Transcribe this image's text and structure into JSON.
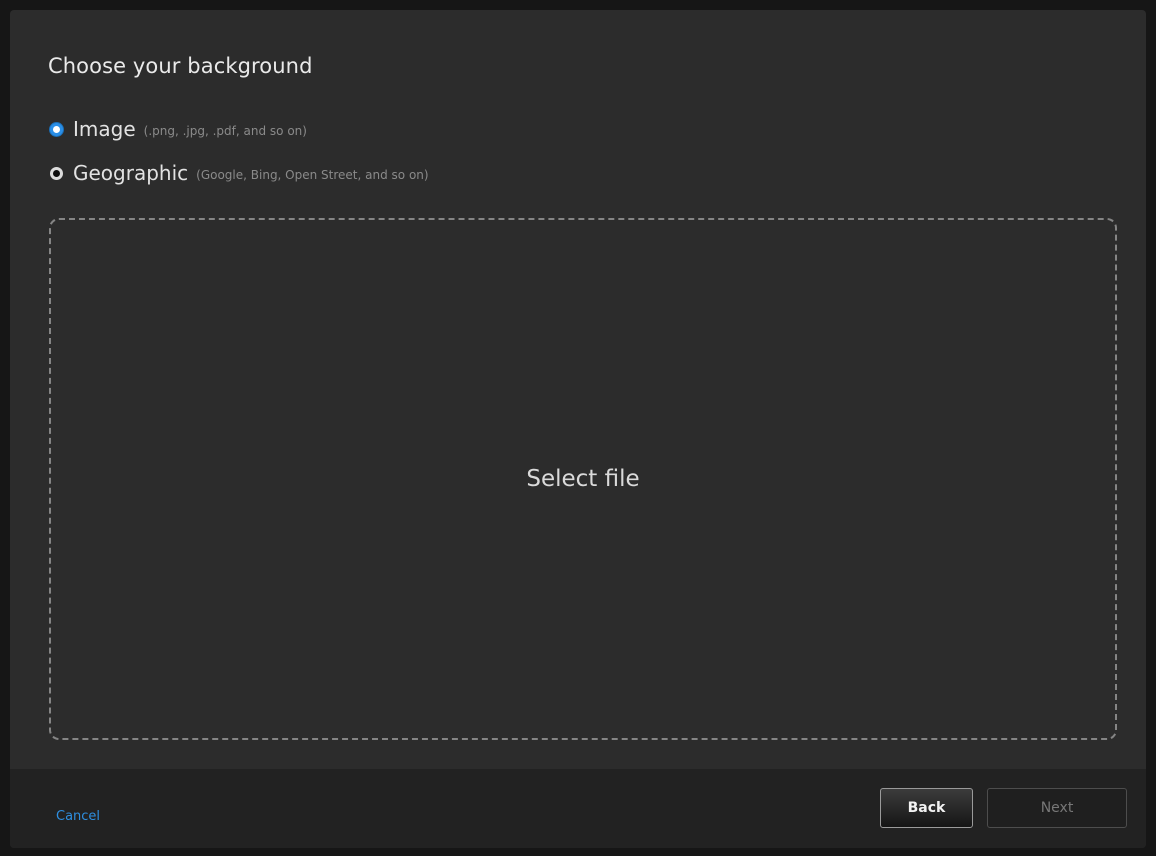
{
  "dialog": {
    "title": "Choose your background",
    "options": [
      {
        "label": "Image",
        "hint": "(.png, .jpg, .pdf, and so on)",
        "selected": true
      },
      {
        "label": "Geographic",
        "hint": "(Google, Bing, Open Street, and so on)",
        "selected": false
      }
    ],
    "dropzone": {
      "label": "Select file"
    }
  },
  "footer": {
    "cancel_label": "Cancel",
    "back_label": "Back",
    "next_label": "Next",
    "next_enabled": false
  },
  "colors": {
    "accent": "#2a8ee6",
    "link": "#2e8fe0",
    "background": "#2c2c2c",
    "footer_background": "#222222"
  }
}
